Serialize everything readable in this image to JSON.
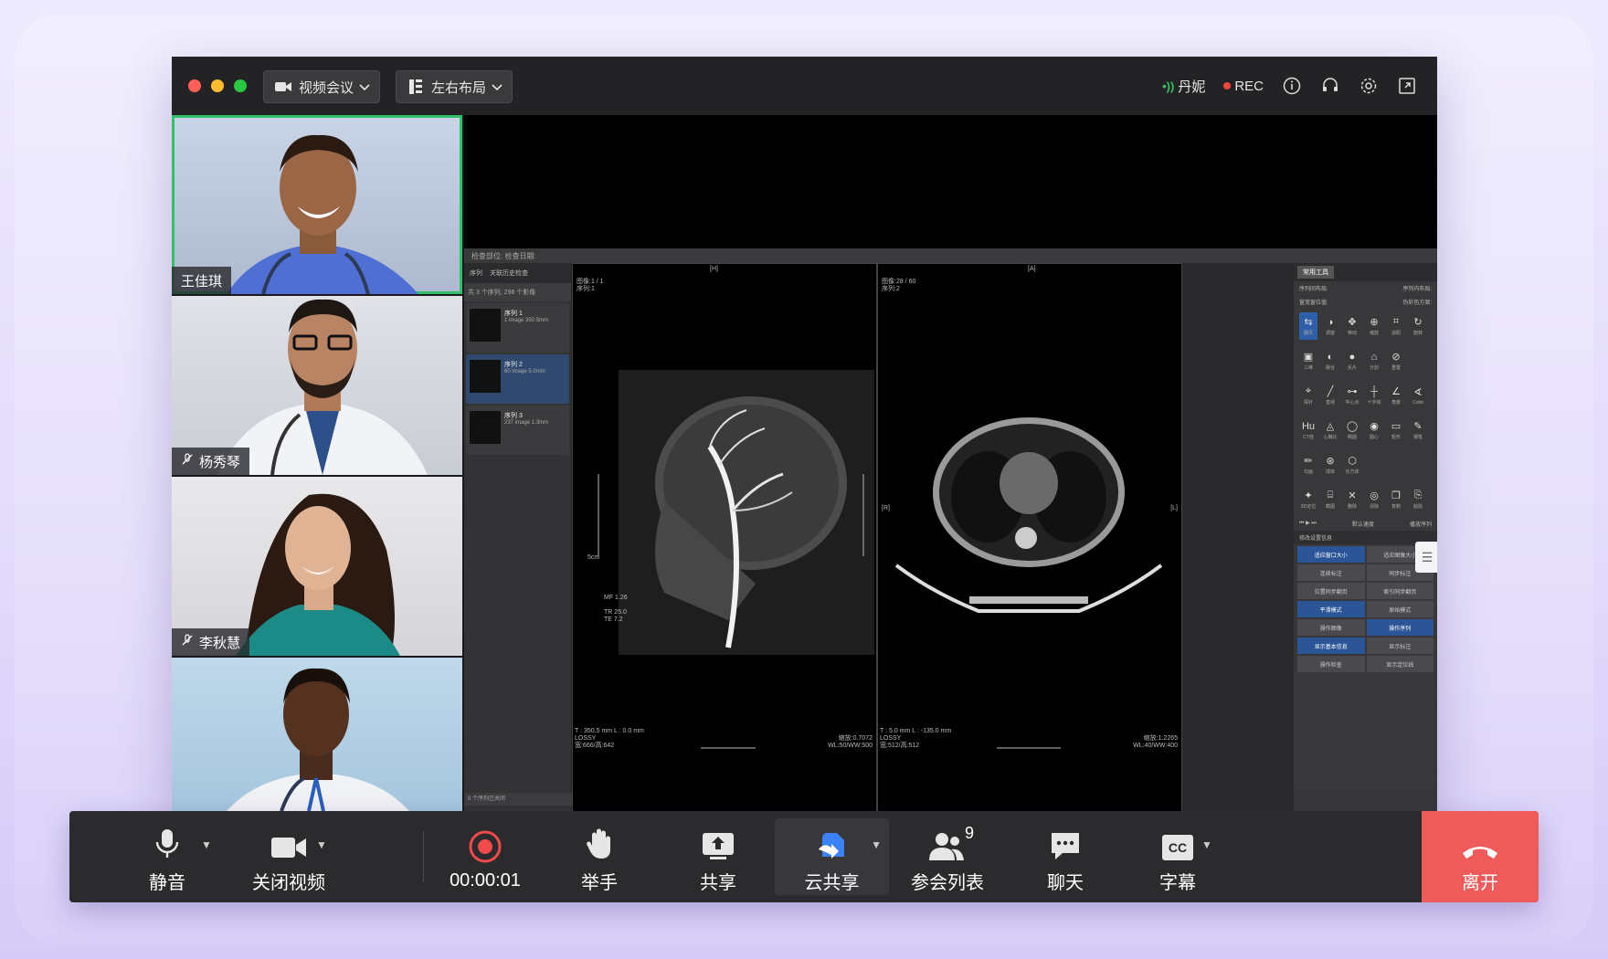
{
  "titlebar": {
    "meeting_mode": "视频会议",
    "layout_mode": "左右布局",
    "speaker": "丹妮",
    "rec_label": "REC"
  },
  "participants": [
    {
      "name": "王佳琪",
      "active": true
    },
    {
      "name": "杨秀琴",
      "muted": true
    },
    {
      "name": "李秋慧",
      "muted": true
    },
    {
      "name": ""
    }
  ],
  "viewer": {
    "header": "检查部位: 检查日期:",
    "tabs": [
      "序列",
      "关联历史检查"
    ],
    "series_count": "共 3 个序列, 298 个影像",
    "series": [
      {
        "title": "序列 1",
        "meta": "1 image    350.5mm"
      },
      {
        "title": "序列 2",
        "meta": "60 image    5.0mm"
      },
      {
        "title": "序列 3",
        "meta": "237 image    1.3mm"
      }
    ],
    "footer": "0 个序列已关闭",
    "left_image": {
      "top_label": "[H]",
      "info": "图像:1 / 1\n序列:1",
      "scale": "5cm",
      "params": "MF 1.26\n\nTR 25.0\nTE 7.2",
      "bottom_left": "T : 350.5 mm L : 0.0 mm\nLOSSY\n宽:666/高:642",
      "bottom_right": "缩放:0.7072\nWL:50/WW:500"
    },
    "right_image": {
      "top_label": "[A]",
      "info": "图像:28 / 60\n序列:2",
      "side_left": "[R]",
      "side_right": "[L]",
      "bottom_left": "T : 5.0 mm L : -135.0 mm\nLOSSY\n宽:512/高:512",
      "bottom_right": "缩放:1.2265\nWL:40/WW:400"
    },
    "tools_tab": "常用工具",
    "dropdowns": [
      "序列间布局:",
      "序列内布局:",
      "窗宽窗位值:",
      "伪彩色方案:"
    ],
    "tool_rows": [
      [
        {
          "g": "⇆",
          "l": "翻页"
        },
        {
          "g": "◑",
          "l": "调窗"
        },
        {
          "g": "✥",
          "l": "移动"
        },
        {
          "g": "⊕",
          "l": "缩放"
        },
        {
          "g": "⌗",
          "l": "适配"
        },
        {
          "g": "↻",
          "l": "旋转"
        }
      ],
      [
        {
          "g": "▣",
          "l": "三维"
        },
        {
          "g": "◐",
          "l": "融合"
        },
        {
          "g": "●",
          "l": "反片"
        },
        {
          "g": "⌂",
          "l": "分割"
        },
        {
          "g": "⊘",
          "l": "重置"
        }
      ],
      [
        {
          "g": "⌖",
          "l": "探针"
        },
        {
          "g": "╱",
          "l": "直线"
        },
        {
          "g": "⊶",
          "l": "中心点"
        },
        {
          "g": "┼",
          "l": "十字线"
        },
        {
          "g": "∠",
          "l": "角度"
        },
        {
          "g": "∢",
          "l": "Cobb"
        }
      ],
      [
        {
          "g": "Hu",
          "l": "CT值"
        },
        {
          "g": "◬",
          "l": "心胸比"
        },
        {
          "g": "◯",
          "l": "椭圆"
        },
        {
          "g": "◉",
          "l": "圆心"
        },
        {
          "g": "▭",
          "l": "矩形"
        },
        {
          "g": "✎",
          "l": "钢笔"
        }
      ],
      [
        {
          "g": "✏",
          "l": "勾画"
        },
        {
          "g": "⊛",
          "l": "球体"
        },
        {
          "g": "⬡",
          "l": "长方体"
        }
      ],
      [
        {
          "g": "✦",
          "l": "3D定位"
        },
        {
          "g": "⌸",
          "l": "截图"
        },
        {
          "g": "✕",
          "l": "删除"
        },
        {
          "g": "◎",
          "l": "清除"
        },
        {
          "g": "❐",
          "l": "复制"
        },
        {
          "g": "⎘",
          "l": "粘贴"
        }
      ]
    ],
    "playback": [
      "默认速度",
      "播放序列"
    ],
    "options_header": "修改设置信息",
    "options": [
      {
        "label": "适应窗口大小",
        "blue": true
      },
      {
        "label": "适应图像大小",
        "blue": false
      },
      {
        "label": "连续标注",
        "blue": false
      },
      {
        "label": "同步标注",
        "blue": false
      },
      {
        "label": "位置同步翻页",
        "blue": false
      },
      {
        "label": "索引同步翻页",
        "blue": false
      },
      {
        "label": "平滑模式",
        "blue": true
      },
      {
        "label": "原始模式",
        "blue": false
      },
      {
        "label": "操作图像",
        "blue": false
      },
      {
        "label": "操作序列",
        "blue": true
      },
      {
        "label": "显示基本信息",
        "blue": true
      },
      {
        "label": "显示标注",
        "blue": false
      }
    ],
    "options_extra": [
      "操作检查",
      "显示定位线"
    ]
  },
  "toolbar": {
    "mute": "静音",
    "video_off": "关闭视频",
    "timer": "00:00:01",
    "raise_hand": "举手",
    "share": "共享",
    "cloud_share": "云共享",
    "participants": "参会列表",
    "participant_count": "9",
    "chat": "聊天",
    "captions": "字幕",
    "captions_badge": "CC",
    "leave": "离开"
  },
  "colors": {
    "accent_green": "#33c06a",
    "rec_red": "#f0463c",
    "leave_red": "#ef5b5b",
    "cloud_blue": "#3b82f6"
  }
}
